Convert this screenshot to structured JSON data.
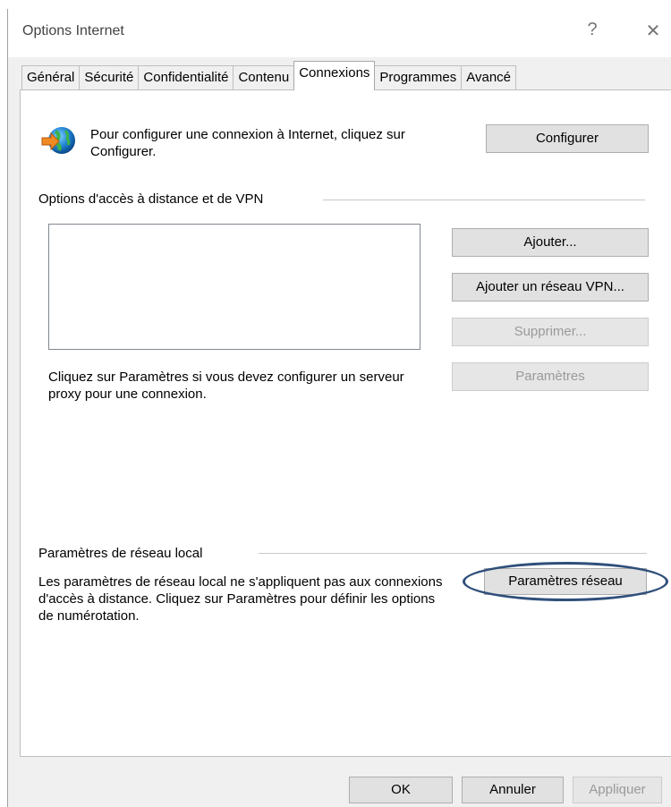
{
  "window": {
    "title": "Options Internet",
    "help_label": "?",
    "close_label": "✕"
  },
  "tabs": [
    {
      "label": "Général"
    },
    {
      "label": "Sécurité"
    },
    {
      "label": "Confidentialité"
    },
    {
      "label": "Contenu"
    },
    {
      "label": "Connexions"
    },
    {
      "label": "Programmes"
    },
    {
      "label": "Avancé"
    }
  ],
  "setup": {
    "text": "Pour configurer une connexion à Internet, cliquez sur Configurer.",
    "button": "Configurer",
    "icon": "globe-arrow-icon"
  },
  "dialup": {
    "group_label": "Options d'accès à distance et de VPN",
    "add_button": "Ajouter...",
    "add_vpn_button": "Ajouter un réseau VPN...",
    "remove_button": "Supprimer...",
    "settings_button": "Paramètres",
    "proxy_text": "Cliquez sur Paramètres si vous devez configurer un serveur proxy pour une connexion."
  },
  "lan": {
    "group_label": "Paramètres de réseau local",
    "text": "Les paramètres de réseau local ne s'appliquent pas aux connexions d'accès à distance. Cliquez sur Paramètres pour définir les options de numérotation.",
    "button": "Paramètres réseau",
    "highlight_color": "#2f4f7a"
  },
  "footer": {
    "ok": "OK",
    "cancel": "Annuler",
    "apply": "Appliquer"
  }
}
